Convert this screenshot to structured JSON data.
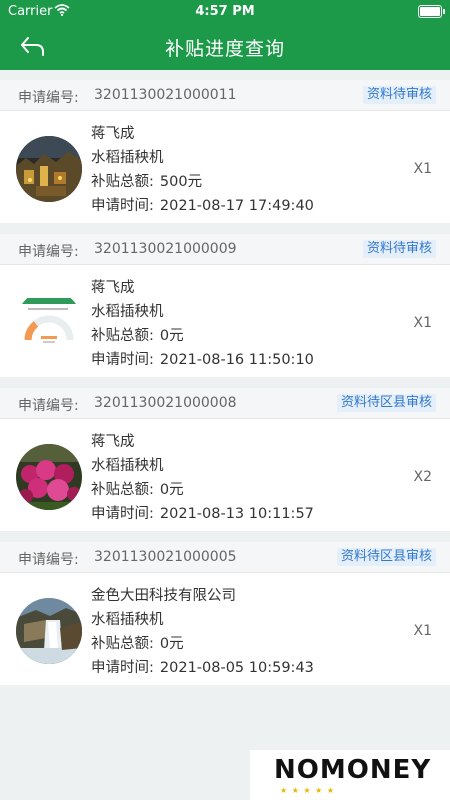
{
  "status_bar": {
    "carrier": "Carrier",
    "time": "4:57 PM"
  },
  "header": {
    "title": "补贴进度查询",
    "back_icon": "back-arrow-icon",
    "color": "#1c9a4a"
  },
  "labels": {
    "application_no": "申请编号:",
    "subsidy_total": "补贴总额:",
    "apply_time": "申请时间:"
  },
  "applications": [
    {
      "number": "3201130021000011",
      "status": "资料待审核",
      "name": "蒋飞成",
      "machine": "水稻插秧机",
      "amount": "500元",
      "time": "2021-08-17 17:49:40",
      "quantity": "X1",
      "thumbnail": "town-night-photo"
    },
    {
      "number": "3201130021000009",
      "status": "资料待审核",
      "name": "蒋飞成",
      "machine": "水稻插秧机",
      "amount": "0元",
      "time": "2021-08-16 11:50:10",
      "quantity": "X1",
      "thumbnail": "progress-gauge-screenshot"
    },
    {
      "number": "3201130021000008",
      "status": "资料待区县审核",
      "name": "蒋飞成",
      "machine": "水稻插秧机",
      "amount": "0元",
      "time": "2021-08-13 10:11:57",
      "quantity": "X2",
      "thumbnail": "flowers-photo"
    },
    {
      "number": "3201130021000005",
      "status": "资料待区县审核",
      "name": "金色大田科技有限公司",
      "machine": "水稻插秧机",
      "amount": "0元",
      "time": "2021-08-05 10:59:43",
      "quantity": "X1",
      "thumbnail": "waterfall-photo"
    }
  ],
  "watermark": {
    "text": "NOMONEY"
  }
}
